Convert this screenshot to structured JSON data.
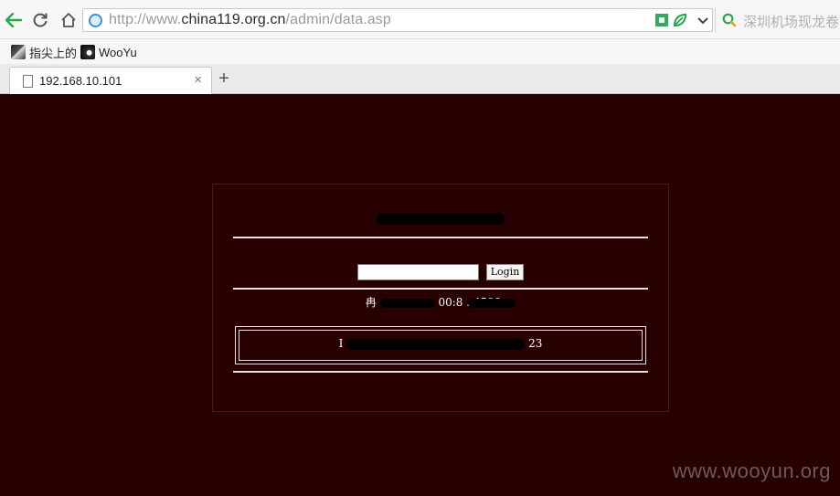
{
  "browser": {
    "url_prefix": "http://www.",
    "url_domain": "china119.org.cn",
    "url_path": "/admin/data.asp",
    "search_placeholder": "深圳机场现龙卷",
    "bookmarks": [
      {
        "label": "指尖上的"
      },
      {
        "label": "WooYu"
      }
    ],
    "tab": {
      "title": "192.168.10.101",
      "close": "×"
    },
    "new_tab": "+"
  },
  "page": {
    "login_button": "Login",
    "password_value": "",
    "info_prefix": "冉",
    "info_suffix": "00:8 . 4598",
    "copyright_prefix": "Ⅰ",
    "copyright_suffix": "23",
    "watermark": "www.wooyun.org"
  },
  "colors": {
    "page_background": "#280000",
    "accent_green": "#1fa34a",
    "nav_green": "#2aa54c"
  }
}
